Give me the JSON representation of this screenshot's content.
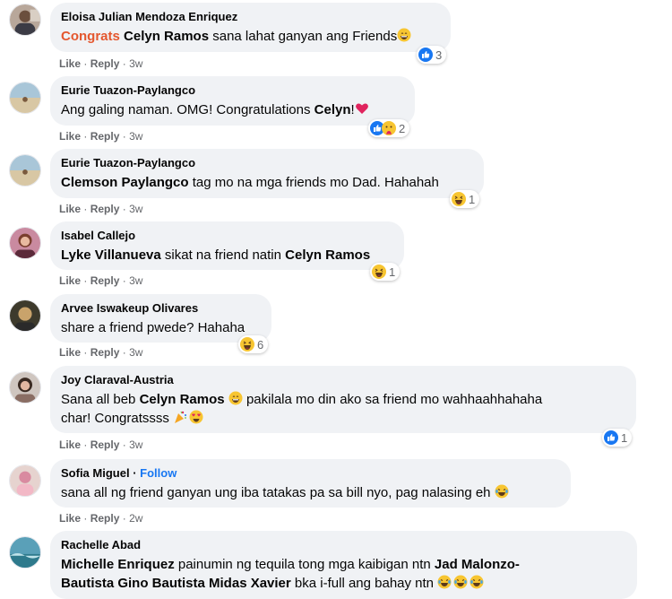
{
  "comments": [
    {
      "author": "Eloisa Julian Mendoza Enriquez",
      "text_parts": [
        "Congrats",
        " ",
        "Celyn Ramos",
        " sana lahat ganyan ang Friends"
      ],
      "like": "Like",
      "reply": "Reply",
      "time": "3w",
      "reactions": [
        "like-icon"
      ],
      "reaction_count": "3"
    },
    {
      "author": "Eurie Tuazon-Paylangco",
      "text_parts": [
        "Ang galing naman. OMG! Congratulations ",
        "Celyn",
        "!"
      ],
      "like": "Like",
      "reply": "Reply",
      "time": "3w",
      "reactions": [
        "like-icon",
        "care-icon"
      ],
      "reaction_count": "2"
    },
    {
      "author": "Eurie Tuazon-Paylangco",
      "text_parts": [
        "Clemson Paylangco",
        " tag mo na mga friends mo Dad. Hahahah"
      ],
      "like": "Like",
      "reply": "Reply",
      "time": "3w",
      "reactions": [
        "haha-icon"
      ],
      "reaction_count": "1"
    },
    {
      "author": "Isabel Callejo",
      "text_parts": [
        "Lyke Villanueva",
        " sikat na friend natin ",
        "Celyn Ramos"
      ],
      "like": "Like",
      "reply": "Reply",
      "time": "3w",
      "reactions": [
        "haha-icon"
      ],
      "reaction_count": "1"
    },
    {
      "author": "Arvee Iswakeup Olivares",
      "text_parts": [
        "share a friend pwede? Hahaha"
      ],
      "like": "Like",
      "reply": "Reply",
      "time": "3w",
      "reactions": [
        "haha-icon"
      ],
      "reaction_count": "6"
    },
    {
      "author": "Joy Claraval-Austria",
      "text_parts": [
        "Sana all beb ",
        "Celyn Ramos",
        " pakilala mo din ako sa friend mo wahhaahhahaha",
        "char! Congratssss "
      ],
      "like": "Like",
      "reply": "Reply",
      "time": "3w",
      "reactions": [
        "like-icon"
      ],
      "reaction_count": "1"
    },
    {
      "author": "Sofia Miguel",
      "follow": "Follow",
      "text_parts": [
        "sana all ng friend ganyan ung iba tatakas pa sa bill nyo, pag nalasing eh "
      ],
      "like": "Like",
      "reply": "Reply",
      "time": "2w"
    },
    {
      "author": "Rachelle Abad",
      "text_parts": [
        "Michelle Enriquez",
        " painumin ng tequila tong mga kaibigan ntn ",
        "Jad Malonzo-",
        "Bautista Gino Bautista Midas Xavier",
        " bka i-full ang bahay ntn "
      ]
    }
  ],
  "separator": "·",
  "colors": {
    "bubble": "#f0f2f5",
    "secondary_text": "#65676b",
    "link_blue": "#1877f2",
    "highlight": "#e4572e"
  }
}
